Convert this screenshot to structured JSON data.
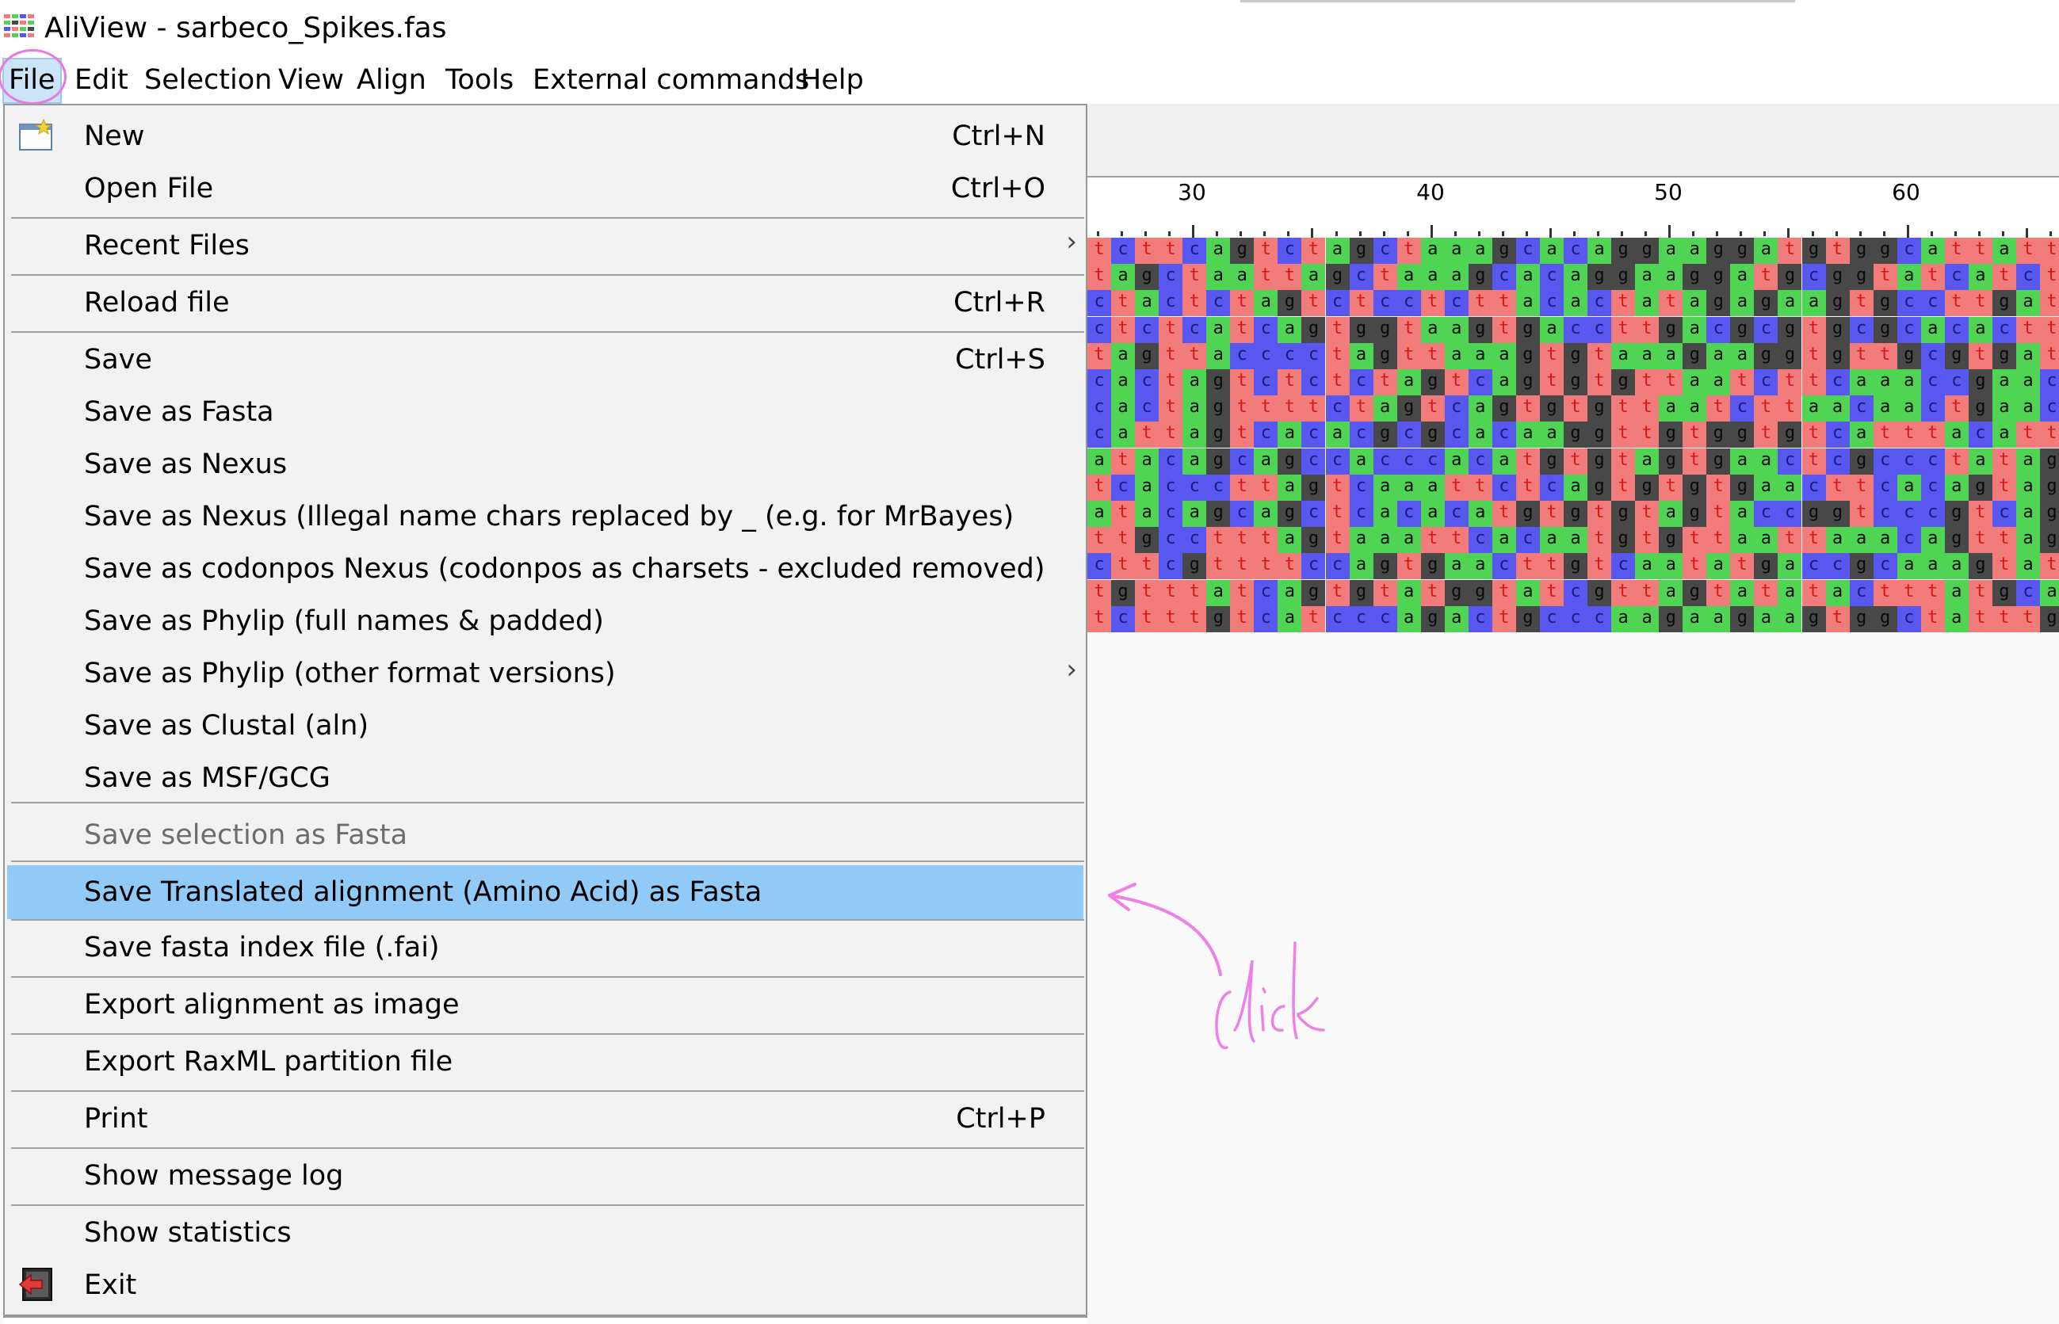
{
  "window": {
    "title": "AliView - sarbeco_Spikes.fas"
  },
  "menubar": {
    "items": [
      "File",
      "Edit",
      "Selection",
      "View",
      "Align",
      "Tools",
      "External commands",
      "Help"
    ]
  },
  "file_menu": {
    "items": [
      {
        "label": "New",
        "shortcut": "Ctrl+N"
      },
      {
        "label": "Open File",
        "shortcut": "Ctrl+O"
      },
      {
        "label": "Recent Files",
        "shortcut": ""
      },
      {
        "label": "Reload file",
        "shortcut": "Ctrl+R"
      },
      {
        "label": "Save",
        "shortcut": "Ctrl+S"
      },
      {
        "label": "Save as Fasta",
        "shortcut": ""
      },
      {
        "label": "Save as Nexus",
        "shortcut": ""
      },
      {
        "label": "Save as Nexus (Illegal name chars replaced by _ (e.g. for MrBayes)",
        "shortcut": ""
      },
      {
        "label": "Save as codonpos Nexus (codonpos as charsets - excluded removed)",
        "shortcut": ""
      },
      {
        "label": "Save as Phylip (full names & padded)",
        "shortcut": ""
      },
      {
        "label": "Save as Phylip (other format versions)",
        "shortcut": ""
      },
      {
        "label": "Save as Clustal (aln)",
        "shortcut": ""
      },
      {
        "label": "Save as MSF/GCG",
        "shortcut": ""
      },
      {
        "label": "Save selection as Fasta",
        "shortcut": ""
      },
      {
        "label": "Save Translated alignment (Amino Acid) as Fasta",
        "shortcut": ""
      },
      {
        "label": "Save fasta index file (.fai)",
        "shortcut": ""
      },
      {
        "label": "Export alignment as image",
        "shortcut": ""
      },
      {
        "label": "Export RaxML partition file",
        "shortcut": ""
      },
      {
        "label": "Print",
        "shortcut": "Ctrl+P"
      },
      {
        "label": "Show message log",
        "shortcut": ""
      },
      {
        "label": "Show statistics",
        "shortcut": ""
      },
      {
        "label": "Exit",
        "shortcut": ""
      }
    ],
    "submenu_arrow": "›"
  },
  "ruler": {
    "labels": [
      "30",
      "40",
      "50",
      "60"
    ]
  },
  "alignment": {
    "colors": {
      "a": "#4fd454",
      "c": "#5858f0",
      "g": "#484848",
      "t": "#f27b7b"
    },
    "text_colors": {
      "a": "#0a0a0a",
      "c": "#1a1a80",
      "g": "#0a0a0a",
      "t": "#d81818"
    },
    "rows": [
      "tcttcagtctagctaaagcacaggaaggatgtggcattatt",
      "tagctaattagctaaagcacaggaaggatgcggtatcatct",
      "ctactctagtctcctcttacactatagagaagtgccttgat",
      "ctctcatcagtggtaagtgaccttgacgcgtgcgcacactt",
      "tagttacccctagttaaagtgtaaagaaggtgttgcgtgat",
      "cactagtctctctagtcagtgtgttaatcttcaaaccgaac",
      "cactagttttctagtcagtgtgttaatcttaacaactgaac",
      "cattagtcacacgcgcacaaggttgtggtgtcatttacatt",
      "atacagcagccacccacatgtgtagtgaactcgccctatag",
      "tcacccttagtcaaattctcagtgtgtgaacttcacagtag",
      "atacagcagctcacacatgtgtgtagtaccggtcccgtcag",
      "ttgcctttagtaaattcacaatgtgttaattaaacagttag",
      "cttcgttttccagtgaacttgtcaatatgaccgcaaagtat",
      "tgtttatcagtgtatggtatcgttagtatatactttatgca",
      "tctttgtcatcccagactgcccaagaagaagtggctatttg"
    ]
  }
}
